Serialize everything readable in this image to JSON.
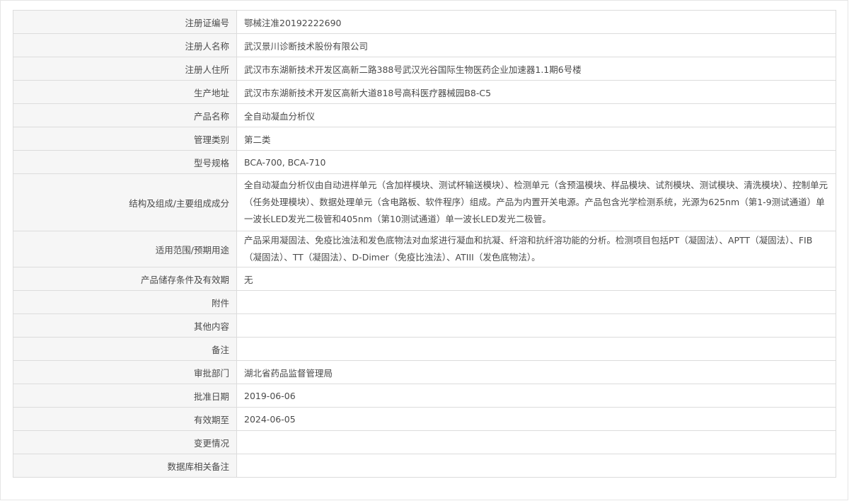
{
  "rows": [
    {
      "label": "注册证编号",
      "value": "鄂械注准20192222690"
    },
    {
      "label": "注册人名称",
      "value": "武汉景川诊断技术股份有限公司"
    },
    {
      "label": "注册人住所",
      "value": "武汉市东湖新技术开发区高新二路388号武汉光谷国际生物医药企业加速器1.1期6号楼"
    },
    {
      "label": "生产地址",
      "value": "武汉市东湖新技术开发区高新大道818号高科医疗器械园B8-C5"
    },
    {
      "label": "产品名称",
      "value": "全自动凝血分析仪"
    },
    {
      "label": "管理类别",
      "value": "第二类"
    },
    {
      "label": "型号规格",
      "value": "BCA-700, BCA-710"
    },
    {
      "label": "结构及组成/主要组成成分",
      "value": "全自动凝血分析仪由自动进样单元（含加样模块、测试杯输送模块）、检测单元（含预温模块、样品模块、试剂模块、测试模块、清洗模块）、控制单元（任务处理模块）、数据处理单元（含电路板、软件程序）组成。产品为内置开关电源。产品包含光学检测系统，光源为625nm（第1-9测试通道）单一波长LED发光二极管和405nm（第10测试通道）单一波长LED发光二极管。"
    },
    {
      "label": "适用范围/预期用途",
      "value": "产品采用凝固法、免疫比浊法和发色底物法对血浆进行凝血和抗凝、纤溶和抗纤溶功能的分析。检测项目包括PT（凝固法）、APTT（凝固法）、FIB（凝固法）、TT（凝固法）、D-Dimer（免疫比浊法）、ATIII（发色底物法）。"
    },
    {
      "label": "产品储存条件及有效期",
      "value": "无"
    },
    {
      "label": "附件",
      "value": ""
    },
    {
      "label": "其他内容",
      "value": ""
    },
    {
      "label": "备注",
      "value": ""
    },
    {
      "label": "审批部门",
      "value": "湖北省药品监督管理局"
    },
    {
      "label": "批准日期",
      "value": "2019-06-06"
    },
    {
      "label": "有效期至",
      "value": "2024-06-05"
    },
    {
      "label": "变更情况",
      "value": ""
    },
    {
      "label": "数据库相关备注",
      "value": ""
    }
  ]
}
